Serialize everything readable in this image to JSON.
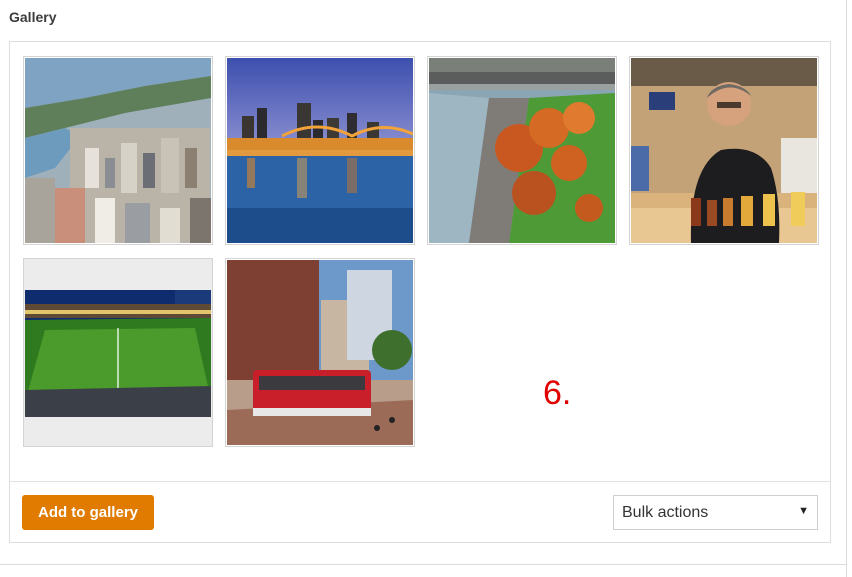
{
  "gallery": {
    "title": "Gallery",
    "images": [
      {
        "icon": "city-aerial-photo"
      },
      {
        "icon": "bridge-night-photo"
      },
      {
        "icon": "riverfront-autumn-photo"
      },
      {
        "icon": "beer-tasting-photo"
      },
      {
        "icon": "soccer-stadium-photo"
      },
      {
        "icon": "streetcar-downtown-photo"
      }
    ]
  },
  "annotation": "6.",
  "footer": {
    "add_button": "Add to gallery",
    "bulk_actions": "Bulk actions"
  },
  "colors": {
    "accent": "#e07b00",
    "annotation": "#e00000"
  }
}
